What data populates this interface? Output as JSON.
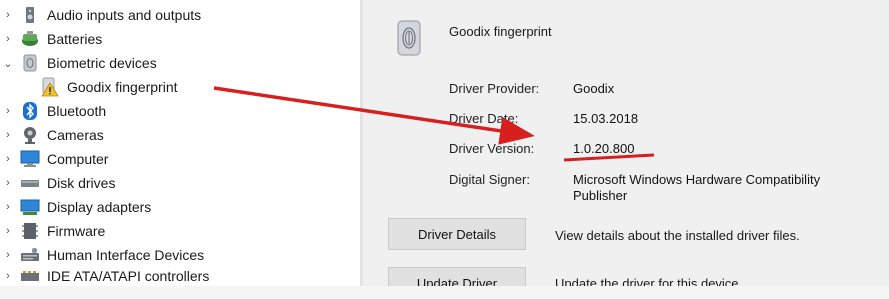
{
  "device_tree": {
    "items": [
      {
        "label": "Audio inputs and outputs",
        "expanded": false,
        "icon": "speaker-icon"
      },
      {
        "label": "Batteries",
        "expanded": false,
        "icon": "battery-icon"
      },
      {
        "label": "Biometric devices",
        "expanded": true,
        "icon": "biometric-icon"
      },
      {
        "label": "Goodix fingerprint",
        "child": true,
        "icon": "fingerprint-warning-icon"
      },
      {
        "label": "Bluetooth",
        "expanded": false,
        "icon": "bluetooth-icon"
      },
      {
        "label": "Cameras",
        "expanded": false,
        "icon": "camera-icon"
      },
      {
        "label": "Computer",
        "expanded": false,
        "icon": "computer-icon"
      },
      {
        "label": "Disk drives",
        "expanded": false,
        "icon": "disk-drive-icon"
      },
      {
        "label": "Display adapters",
        "expanded": false,
        "icon": "display-adapter-icon"
      },
      {
        "label": "Firmware",
        "expanded": false,
        "icon": "firmware-icon"
      },
      {
        "label": "Human Interface Devices",
        "expanded": false,
        "icon": "hid-icon"
      },
      {
        "label": "IDE ATA/ATAPI controllers",
        "expanded": false,
        "icon": "ide-controller-icon"
      }
    ]
  },
  "driver_panel": {
    "device_name": "Goodix fingerprint",
    "provider_label": "Driver Provider:",
    "provider_value": "Goodix",
    "date_label": "Driver Date:",
    "date_value": "15.03.2018",
    "version_label": "Driver Version:",
    "version_value": "1.0.20.800",
    "signer_label": "Digital Signer:",
    "signer_value": "Microsoft Windows Hardware Compatibility Publisher",
    "details_button": "Driver Details",
    "details_desc": "View details about the installed driver files.",
    "update_button": "Update Driver",
    "update_desc": "Update the driver for this device."
  },
  "annotation": {
    "color": "#d81f1f"
  }
}
